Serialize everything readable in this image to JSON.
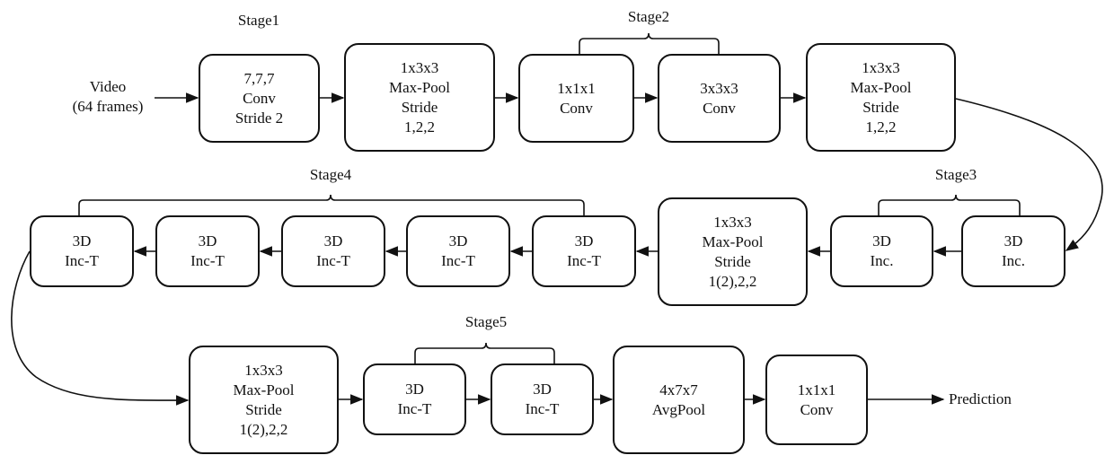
{
  "diagram": {
    "input": {
      "lines": [
        "Video",
        "(64 frames)"
      ]
    },
    "output": {
      "label": "Prediction"
    },
    "stages": [
      {
        "id": "stage1",
        "label": "Stage1"
      },
      {
        "id": "stage2",
        "label": "Stage2"
      },
      {
        "id": "stage3",
        "label": "Stage3"
      },
      {
        "id": "stage4",
        "label": "Stage4"
      },
      {
        "id": "stage5",
        "label": "Stage5"
      }
    ],
    "nodes": [
      {
        "id": "conv7",
        "lines": [
          "7,7,7",
          "Conv",
          "Stride 2"
        ]
      },
      {
        "id": "pool1",
        "lines": [
          "1x3x3",
          "Max-Pool",
          "Stride",
          "1,2,2"
        ]
      },
      {
        "id": "conv1x1",
        "lines": [
          "1x1x1",
          "Conv"
        ]
      },
      {
        "id": "conv3x3",
        "lines": [
          "3x3x3",
          "Conv"
        ]
      },
      {
        "id": "pool2",
        "lines": [
          "1x3x3",
          "Max-Pool",
          "Stride",
          "1,2,2"
        ]
      },
      {
        "id": "inc3b",
        "lines": [
          "3D",
          "Inc."
        ]
      },
      {
        "id": "inc3a",
        "lines": [
          "3D",
          "Inc."
        ]
      },
      {
        "id": "pool3",
        "lines": [
          "1x3x3",
          "Max-Pool",
          "Stride",
          "1(2),2,2"
        ]
      },
      {
        "id": "inc4a",
        "lines": [
          "3D",
          "Inc-T"
        ]
      },
      {
        "id": "inc4b",
        "lines": [
          "3D",
          "Inc-T"
        ]
      },
      {
        "id": "inc4c",
        "lines": [
          "3D",
          "Inc-T"
        ]
      },
      {
        "id": "inc4d",
        "lines": [
          "3D",
          "Inc-T"
        ]
      },
      {
        "id": "inc4e",
        "lines": [
          "3D",
          "Inc-T"
        ]
      },
      {
        "id": "pool4",
        "lines": [
          "1x3x3",
          "Max-Pool",
          "Stride",
          "1(2),2,2"
        ]
      },
      {
        "id": "inc5a",
        "lines": [
          "3D",
          "Inc-T"
        ]
      },
      {
        "id": "inc5b",
        "lines": [
          "3D",
          "Inc-T"
        ]
      },
      {
        "id": "avgpool",
        "lines": [
          "4x7x7",
          "AvgPool"
        ]
      },
      {
        "id": "convout",
        "lines": [
          "1x1x1",
          "Conv"
        ]
      }
    ],
    "edges": [
      [
        "input",
        "conv7"
      ],
      [
        "conv7",
        "pool1"
      ],
      [
        "pool1",
        "conv1x1"
      ],
      [
        "conv1x1",
        "conv3x3"
      ],
      [
        "conv3x3",
        "pool2"
      ],
      [
        "pool2",
        "inc3a"
      ],
      [
        "inc3a",
        "inc3b"
      ],
      [
        "inc3b",
        "pool3"
      ],
      [
        "pool3",
        "inc4a"
      ],
      [
        "inc4a",
        "inc4b"
      ],
      [
        "inc4b",
        "inc4c"
      ],
      [
        "inc4c",
        "inc4d"
      ],
      [
        "inc4d",
        "inc4e"
      ],
      [
        "inc4e",
        "pool4"
      ],
      [
        "pool4",
        "inc5a"
      ],
      [
        "inc5a",
        "inc5b"
      ],
      [
        "inc5b",
        "avgpool"
      ],
      [
        "avgpool",
        "convout"
      ],
      [
        "convout",
        "output"
      ]
    ]
  }
}
